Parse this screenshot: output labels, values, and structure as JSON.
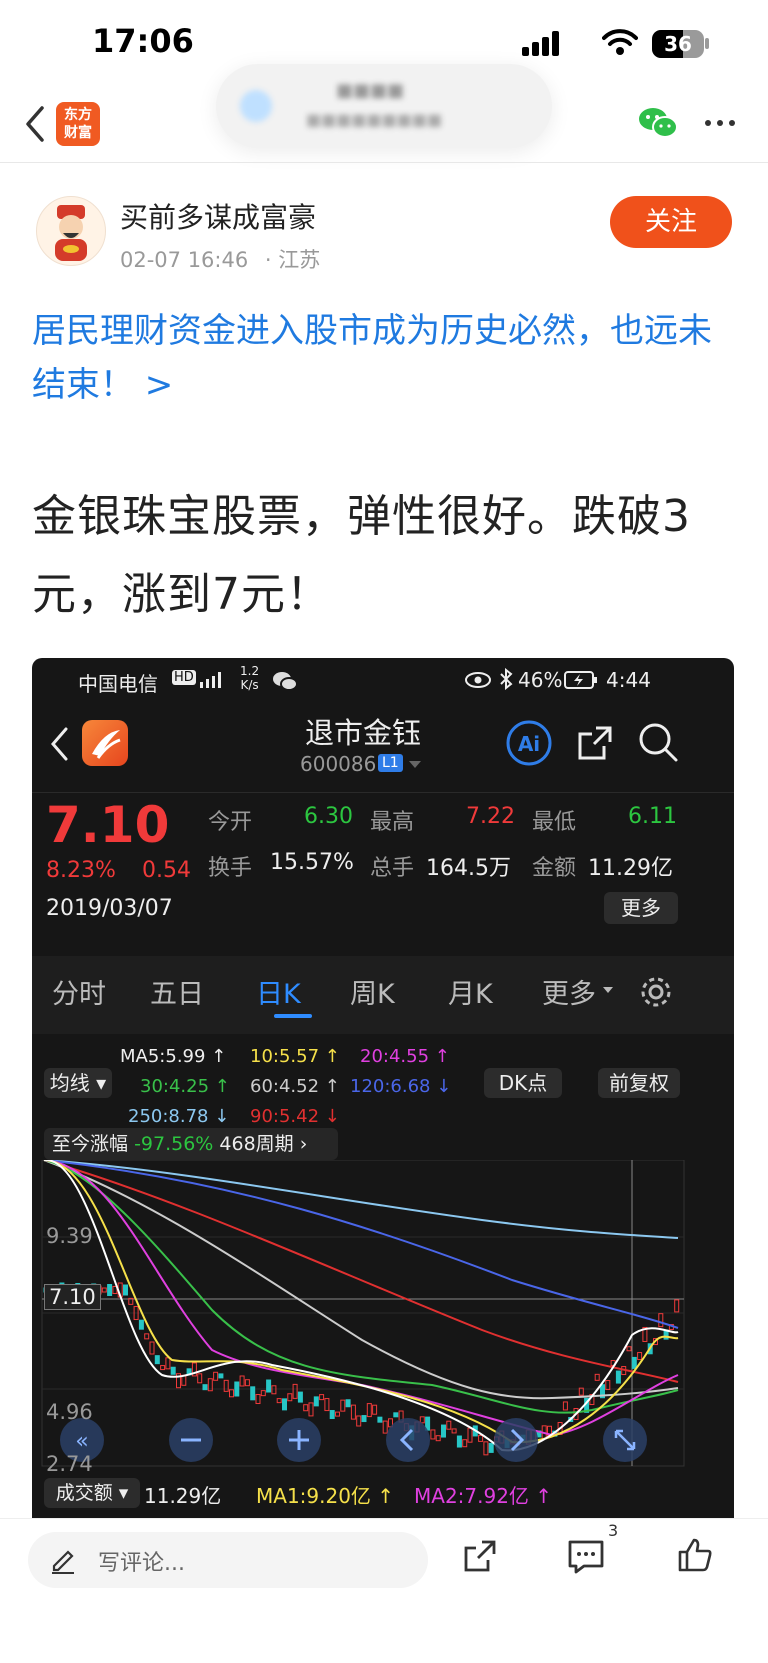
{
  "status_bar": {
    "time": "17:06",
    "battery": "36"
  },
  "nav": {
    "logo_line1": "东方",
    "logo_line2": "财富"
  },
  "author": {
    "name": "买前多谋成富豪",
    "date": "02-07 16:46",
    "location": "· 江苏",
    "follow_label": "关注"
  },
  "topic": "居民理财资金进入股市成为历史必然，也远未结束！ >",
  "content": "金银珠宝股票，弹性很好。跌破3元，涨到7元！",
  "screenshot": {
    "status": {
      "carrier": "中国电信",
      "net_speed_top": "1.2",
      "net_speed_bottom": "K/s",
      "battery": "46%",
      "time": "4:44"
    },
    "stock": {
      "name": "退市金钰",
      "code": "600086",
      "level": "L1"
    },
    "quote": {
      "price": "7.10",
      "change_pct": "8.23%",
      "change": "0.54",
      "date": "2019/03/07",
      "open_label": "今开",
      "open": "6.30",
      "high_label": "最高",
      "high": "7.22",
      "low_label": "最低",
      "low": "6.11",
      "turnover_label": "换手",
      "turnover": "15.57%",
      "volume_label": "总手",
      "volume": "164.5万",
      "amount_label": "金额",
      "amount": "11.29亿",
      "more_label": "更多"
    },
    "tabs": [
      "分时",
      "五日",
      "日K",
      "周K",
      "月K",
      "更多"
    ],
    "active_tab": "日K",
    "ma": {
      "selector": "均线",
      "ma5": "MA5:5.99",
      "ma10": "10:5.57",
      "ma20": "20:4.55",
      "ma30": "30:4.25",
      "ma60": "60:4.52",
      "ma120": "120:6.68",
      "ma250": "250:8.78",
      "ma90": "90:5.42",
      "dk_label": "DK点",
      "adjust_label": "前复权"
    },
    "range": {
      "label": "至今涨幅",
      "value": "-97.56%",
      "period": "468周期"
    },
    "price_axis": {
      "top": "9.39",
      "marker": "7.10",
      "mid": "4.96",
      "bottom": "2.74"
    },
    "volume_bar": {
      "label": "成交额",
      "value": "11.29亿",
      "ma1": "MA1:9.20亿",
      "ma2": "MA2:7.92亿"
    },
    "colors": {
      "ma5": "#ffffff",
      "ma10": "#f5e04a",
      "ma20": "#e040e0",
      "ma30": "#39c04a",
      "ma60": "#cccccc",
      "ma120": "#4a66e8",
      "ma250": "#8cc8f0",
      "ma90": "#e03030"
    }
  },
  "bottom_bar": {
    "comment_placeholder": "写评论...",
    "comment_count": "3"
  },
  "colors": {
    "accent": "#f0511b",
    "link": "#1f7ae0",
    "up": "#f03a3a",
    "down": "#2cc640"
  }
}
